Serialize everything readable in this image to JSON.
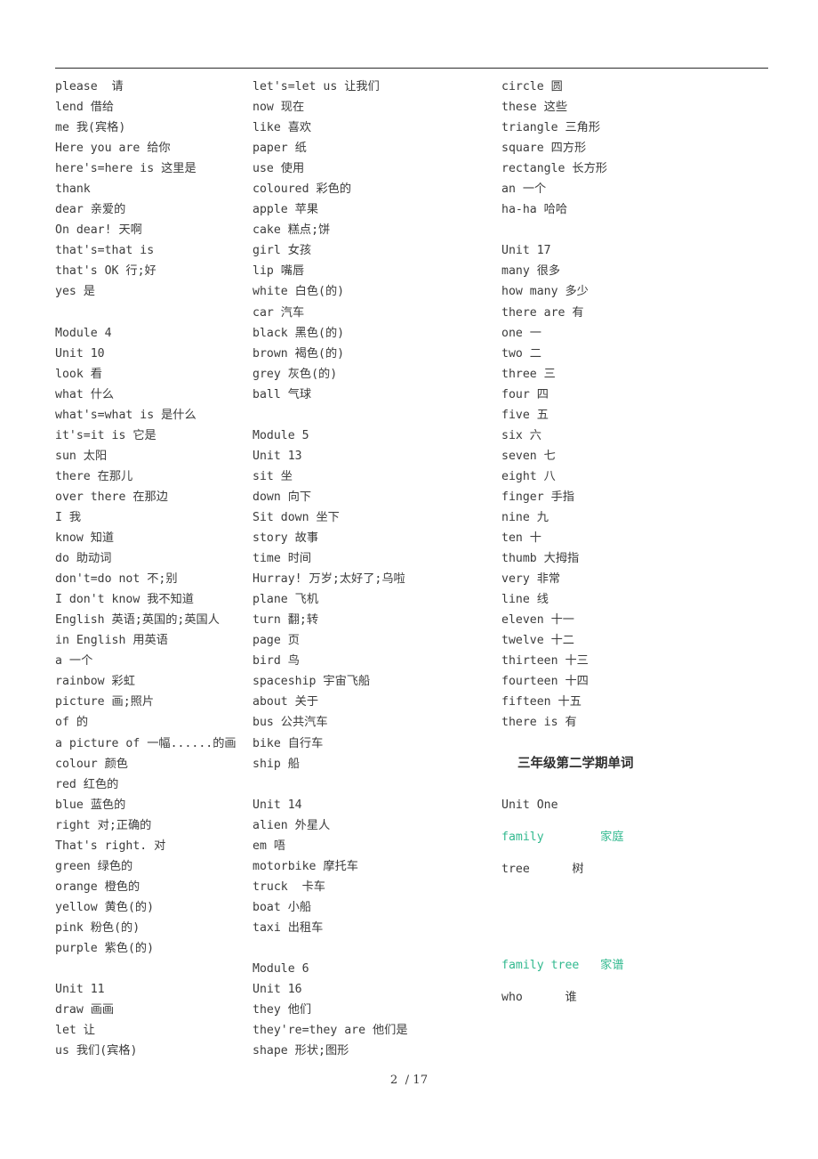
{
  "document": {
    "page_footer": "2  / 17",
    "accent_color": "#32b98f",
    "text_color": "#3b3b3b"
  },
  "columns": [
    {
      "name": "column-left",
      "entries": [
        {
          "text": "please  请"
        },
        {
          "text": "lend 借给"
        },
        {
          "text": "me 我(宾格)"
        },
        {
          "text": "Here you are 给你"
        },
        {
          "text": "here's=here is 这里是"
        },
        {
          "text": "thank"
        },
        {
          "text": "dear 亲爱的"
        },
        {
          "text": "On dear! 天啊"
        },
        {
          "text": "that's=that is"
        },
        {
          "text": "that's OK 行;好"
        },
        {
          "text": "yes 是"
        },
        {
          "text": "",
          "blank": true
        },
        {
          "text": "Module 4"
        },
        {
          "text": "Unit 10"
        },
        {
          "text": "look 看"
        },
        {
          "text": "what 什么"
        },
        {
          "text": "what's=what is 是什么"
        },
        {
          "text": "it's=it is 它是"
        },
        {
          "text": "sun 太阳"
        },
        {
          "text": "there 在那儿"
        },
        {
          "text": "over there 在那边"
        },
        {
          "text": "I 我"
        },
        {
          "text": "know 知道"
        },
        {
          "text": "do 助动词"
        },
        {
          "text": "don't=do not 不;别"
        },
        {
          "text": "I don't know 我不知道"
        },
        {
          "text": "English 英语;英国的;英国人"
        },
        {
          "text": "in English 用英语"
        },
        {
          "text": "a 一个"
        },
        {
          "text": "rainbow 彩虹"
        },
        {
          "text": "picture 画;照片"
        },
        {
          "text": "of 的"
        },
        {
          "text": "a picture of 一幅......的画"
        },
        {
          "text": "colour 颜色"
        },
        {
          "text": "red 红色的"
        },
        {
          "text": "blue 蓝色的"
        },
        {
          "text": "right 对;正确的"
        },
        {
          "text": "That's right. 对"
        },
        {
          "text": "green 绿色的"
        },
        {
          "text": "orange 橙色的"
        },
        {
          "text": "yellow 黄色(的)"
        },
        {
          "text": "pink 粉色(的)"
        },
        {
          "text": "purple 紫色(的)"
        },
        {
          "text": "",
          "blank": true
        },
        {
          "text": "Unit 11"
        },
        {
          "text": "draw 画画"
        },
        {
          "text": "let 让"
        },
        {
          "text": "us 我们(宾格)"
        }
      ]
    },
    {
      "name": "column-middle",
      "entries": [
        {
          "text": "let's=let us 让我们"
        },
        {
          "text": "now 现在"
        },
        {
          "text": "like 喜欢"
        },
        {
          "text": "paper 纸"
        },
        {
          "text": "use 使用"
        },
        {
          "text": "coloured 彩色的"
        },
        {
          "text": "apple 苹果"
        },
        {
          "text": "cake 糕点;饼"
        },
        {
          "text": "girl 女孩"
        },
        {
          "text": "lip 嘴唇"
        },
        {
          "text": "white 白色(的)"
        },
        {
          "text": "car 汽车"
        },
        {
          "text": "black 黑色(的)"
        },
        {
          "text": "brown 褐色(的)"
        },
        {
          "text": "grey 灰色(的)"
        },
        {
          "text": "ball 气球"
        },
        {
          "text": "",
          "blank": true
        },
        {
          "text": "Module 5"
        },
        {
          "text": "Unit 13"
        },
        {
          "text": "sit 坐"
        },
        {
          "text": "down 向下"
        },
        {
          "text": "Sit down 坐下"
        },
        {
          "text": "story 故事"
        },
        {
          "text": "time 时间"
        },
        {
          "text": "Hurray! 万岁;太好了;乌啦"
        },
        {
          "text": "plane 飞机"
        },
        {
          "text": "turn 翻;转"
        },
        {
          "text": "page 页"
        },
        {
          "text": "bird 鸟"
        },
        {
          "text": "spaceship 宇宙飞船"
        },
        {
          "text": "about 关于"
        },
        {
          "text": "bus 公共汽车"
        },
        {
          "text": "bike 自行车"
        },
        {
          "text": "ship 船"
        },
        {
          "text": "",
          "blank": true
        },
        {
          "text": "Unit 14"
        },
        {
          "text": "alien 外星人"
        },
        {
          "text": "em 唔"
        },
        {
          "text": "motorbike 摩托车"
        },
        {
          "text": "truck  卡车"
        },
        {
          "text": "boat 小船"
        },
        {
          "text": "taxi 出租车"
        },
        {
          "text": "",
          "blank": true
        },
        {
          "text": "Module 6"
        },
        {
          "text": "Unit 16"
        },
        {
          "text": "they 他们"
        },
        {
          "text": "they're=they are 他们是"
        },
        {
          "text": "shape 形状;图形"
        }
      ]
    },
    {
      "name": "column-right",
      "entries": [
        {
          "text": "circle 圆"
        },
        {
          "text": "these 这些"
        },
        {
          "text": "triangle 三角形"
        },
        {
          "text": "square 四方形"
        },
        {
          "text": "rectangle 长方形"
        },
        {
          "text": "an 一个"
        },
        {
          "text": "ha-ha 哈哈"
        },
        {
          "text": "",
          "blank": true
        },
        {
          "text": "Unit 17"
        },
        {
          "text": "many 很多"
        },
        {
          "text": "how many 多少"
        },
        {
          "text": "there are 有"
        },
        {
          "text": "one 一"
        },
        {
          "text": "two 二"
        },
        {
          "text": "three 三"
        },
        {
          "text": "four 四"
        },
        {
          "text": "five 五"
        },
        {
          "text": "six 六"
        },
        {
          "text": "seven 七"
        },
        {
          "text": "eight 八"
        },
        {
          "text": "finger 手指"
        },
        {
          "text": "nine 九"
        },
        {
          "text": "ten 十"
        },
        {
          "text": "thumb 大拇指"
        },
        {
          "text": "very 非常"
        },
        {
          "text": "line 线"
        },
        {
          "text": "eleven 十一"
        },
        {
          "text": "twelve 十二"
        },
        {
          "text": "thirteen 十三"
        },
        {
          "text": "fourteen 十四"
        },
        {
          "text": "fifteen 十五"
        },
        {
          "text": "there is 有"
        }
      ],
      "sub_section": {
        "heading": "三年级第二学期单词",
        "entries": [
          {
            "text": "Unit One"
          },
          {
            "text": "family        家庭",
            "teal": true
          },
          {
            "text": "tree      树"
          },
          {
            "text": "",
            "blank": true
          },
          {
            "text": "",
            "blank": true
          },
          {
            "text": "family tree   家谱",
            "teal": true
          },
          {
            "text": "who      谁"
          }
        ]
      }
    }
  ]
}
